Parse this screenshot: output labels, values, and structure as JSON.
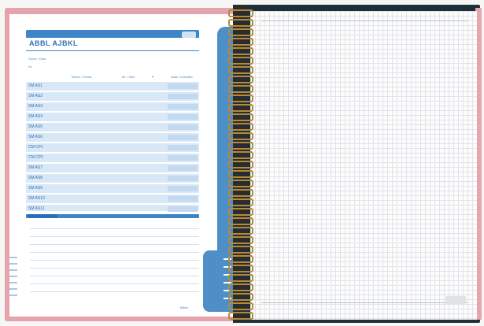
{
  "left_sheet": {
    "title": "ABBL AJBKL",
    "label_name": "Nome / Data",
    "label_no": "Nr.",
    "column_headers": [
      "Nome / Turma",
      "Nr. / Obs",
      "P",
      "Nota / Conceito"
    ],
    "rows": [
      "SM AS1",
      "SM AS2",
      "SM AS3",
      "SM AS4",
      "SM AS5",
      "SM AS6",
      "CM CP1",
      "CM CP2",
      "SM AS7",
      "SM AS8",
      "SM AS9",
      "SM AS10",
      "SM AS11"
    ],
    "footer": "tilibra"
  },
  "colors": {
    "left_cover": "#e6a3ac",
    "accent_blue": "#3d85c6",
    "row_fill": "#d9e8f7",
    "right_cover": "#1f2f3a",
    "ring": "#b58a3a",
    "grid_line": "#e1e4e8"
  }
}
